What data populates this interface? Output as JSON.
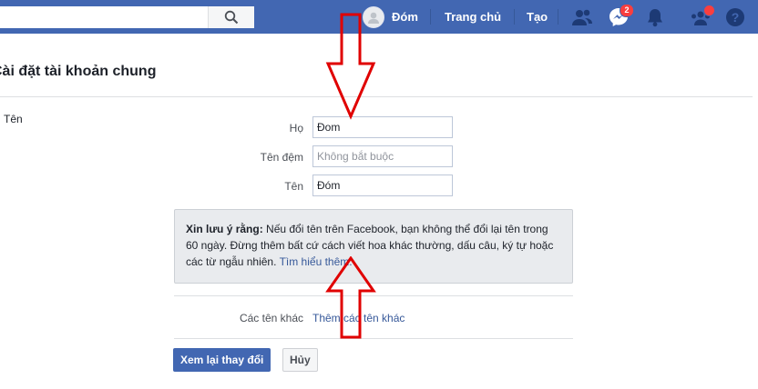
{
  "topbar": {
    "search": {
      "value": "",
      "placeholder": ""
    },
    "profile_name": "Đóm",
    "home_label": "Trang chủ",
    "create_label": "Tạo",
    "messenger_badge": "2",
    "icons": [
      "friends-icon",
      "messenger-icon",
      "bell-icon",
      "groups-icon",
      "help-icon"
    ]
  },
  "page": {
    "title": "Cài đặt tài khoản chung",
    "section_label": "Tên"
  },
  "form": {
    "last_name_label": "Họ",
    "last_name_value": "Đom",
    "middle_name_label": "Tên đệm",
    "middle_name_placeholder": "Không bắt buộc",
    "first_name_label": "Tên",
    "first_name_value": "Đóm"
  },
  "notice": {
    "bold": "Xin lưu ý rằng:",
    "text": " Nếu đổi tên trên Facebook, bạn không thể đổi lại tên trong 60 ngày. Đừng thêm bất cứ cách viết hoa khác thường, dấu câu, ký tự hoặc các từ ngẫu nhiên. ",
    "link": "Tìm hiểu thêm."
  },
  "other_names": {
    "label": "Các tên khác",
    "link": "Thêm các tên khác"
  },
  "buttons": {
    "review": "Xem lại thay đổi",
    "cancel": "Hủy"
  },
  "colors": {
    "topbar": "#4267b2",
    "link": "#365899",
    "annotation_arrow": "#e00000"
  }
}
